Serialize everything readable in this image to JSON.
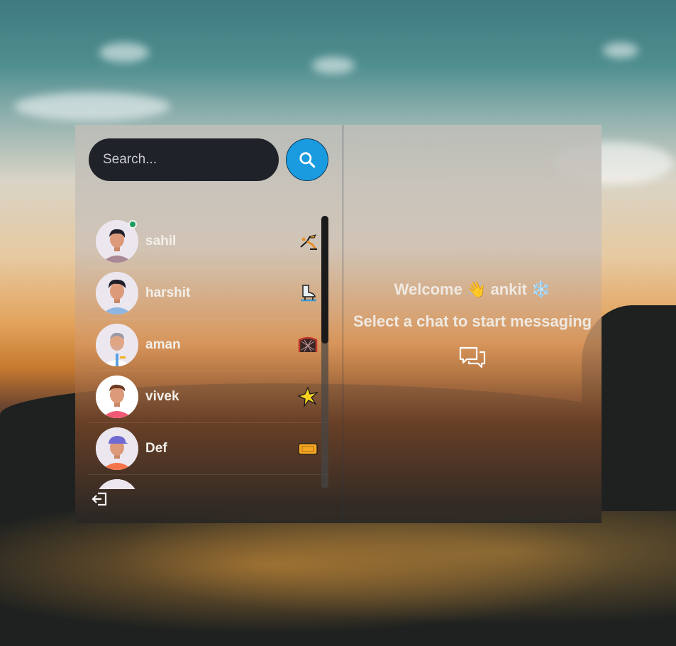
{
  "search": {
    "placeholder": "Search..."
  },
  "contacts": [
    {
      "name": "sahil",
      "online": true,
      "emoji": "person-ice-skating-icon"
    },
    {
      "name": "harshit",
      "online": false,
      "emoji": "ice-skate-icon"
    },
    {
      "name": "aman",
      "online": false,
      "emoji": "goal-net-icon"
    },
    {
      "name": "vivek",
      "online": false,
      "emoji": "sparkle-star-icon"
    },
    {
      "name": "Def",
      "online": false,
      "emoji": "ticket-icon"
    }
  ],
  "welcome": {
    "greeting": "Welcome",
    "wave": "👋",
    "user": "ankit",
    "snow": "❄️"
  },
  "empty_state": {
    "message": "Select a chat to start messaging"
  },
  "colors": {
    "search_button": "#1a9be0",
    "online": "#1a9d5b",
    "search_input": "#1f2329"
  }
}
